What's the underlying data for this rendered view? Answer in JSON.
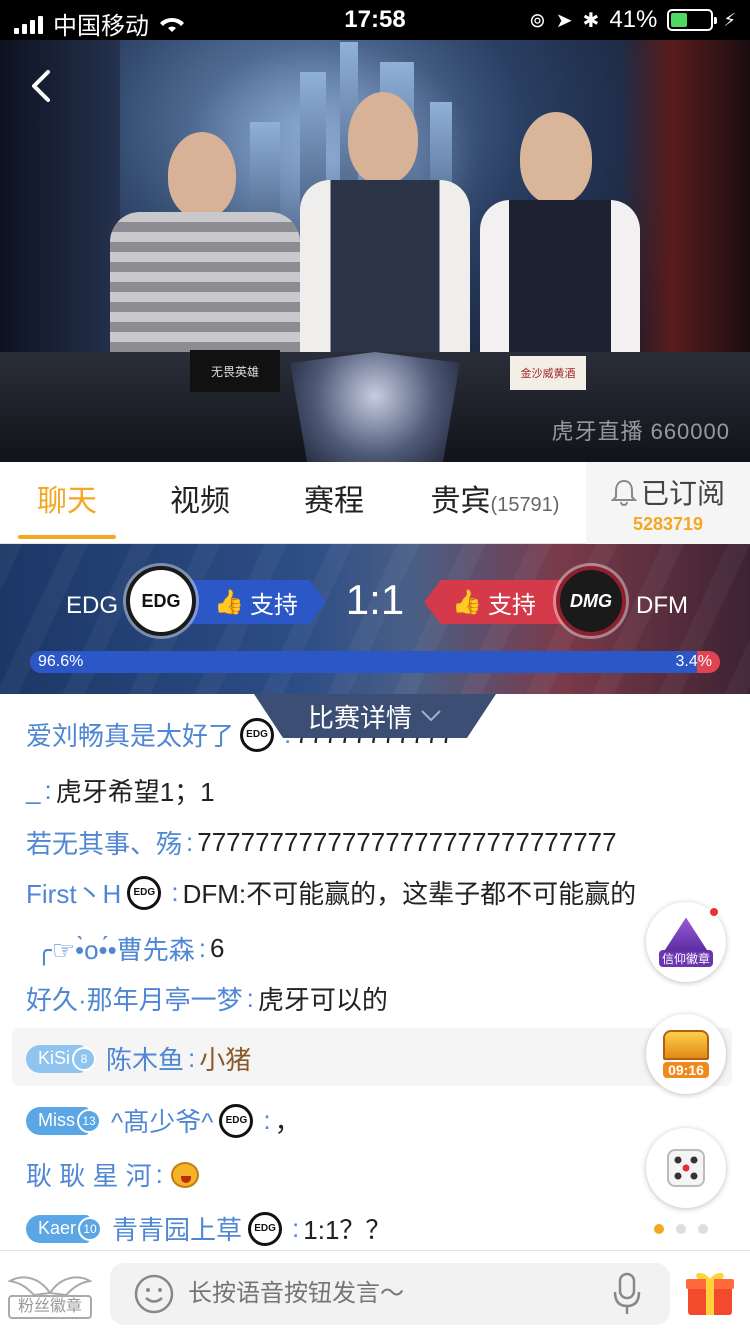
{
  "status_bar": {
    "carrier": "中国移动",
    "time": "17:58",
    "battery": "41%",
    "battery_level": 0.41
  },
  "video": {
    "watermark": "虎牙直播 660000",
    "desk_sign": "无畏英雄",
    "sponsor_sign": "金沙威黄酒"
  },
  "tabs": {
    "chat": "聊天",
    "video": "视频",
    "schedule": "赛程",
    "vip": "贵宾",
    "vip_count": "(15791)",
    "subscribe_label": "已订阅",
    "subscribe_count": "5283719"
  },
  "match": {
    "team_left": "EDG",
    "team_right": "DFM",
    "logo_left": "EDG",
    "logo_right": "DMG",
    "support_label": "支持",
    "score": "1:1",
    "vote_left": "96.6%",
    "vote_right": "3.4%",
    "vote_left_fraction": 0.966,
    "details_label": "比赛详情"
  },
  "chat": [
    {
      "user": "爱刘畅真是太好了",
      "text": "77777777777",
      "edg": true
    },
    {
      "user": "_",
      "text": "虎牙希望1；1"
    },
    {
      "user": "若无其事、殇",
      "text": "77777777777777777777777777777"
    },
    {
      "user": "First丶H",
      "text": "DFM:不可能赢的，这辈子都不可能赢的",
      "edg": true
    },
    {
      "user": "╭☞•̀o•́•曹先森",
      "text": "6"
    },
    {
      "user": "好久·那年月亭一梦",
      "text": "虎牙可以的"
    },
    {
      "user": "陈木鱼",
      "text": "小猪",
      "badge": "KiSi",
      "badge_level": "8"
    },
    {
      "user": "^髙少爷^",
      "text": "，",
      "badge": "Miss",
      "badge_level": "13",
      "edg": true
    },
    {
      "user": "耿 耿 星 河",
      "text": ""
    },
    {
      "user": "青青园上草",
      "text": "1:1？？",
      "badge": "Kaer",
      "badge_level": "10",
      "edg": true
    }
  ],
  "floating": {
    "faith_badge": "信仰徽章",
    "chest_timer": "09:16"
  },
  "bottom": {
    "fan_badge": "粉丝徽章",
    "input_placeholder": "长按语音按钮发言～"
  },
  "colors": {
    "accent": "#f5a623",
    "username": "#4f87d4",
    "team_blue": "#2b57c7",
    "team_red": "#d43a4a"
  },
  "icons": [
    "back-icon",
    "bell-icon",
    "thumb-up-icon",
    "chevron-down-icon",
    "emoji-icon",
    "microphone-icon",
    "gift-icon",
    "dice-icon",
    "treasure-chest-icon",
    "faith-badge-icon",
    "wings-icon"
  ]
}
